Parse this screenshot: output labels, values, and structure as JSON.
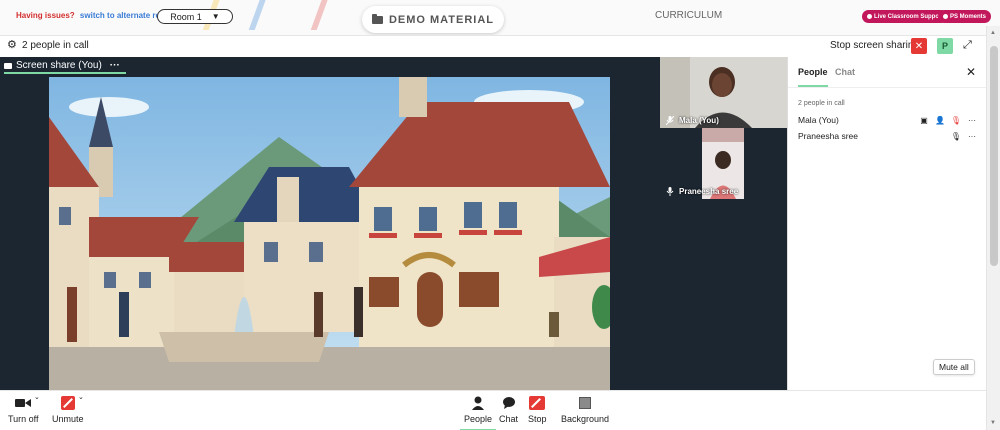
{
  "topbar": {
    "issues_question": "Having issues?",
    "issues_link": "switch to alternate room",
    "room_value": "Room 1",
    "demo_button": "DEMO MATERIAL",
    "curriculum_label": "CURRICULUM",
    "live_support": "Live Classroom Support",
    "ps_moments": "PS Moments"
  },
  "callbar": {
    "people_count": "2 people in call",
    "stop_sharing_label": "Stop screen sharing",
    "stop_sharing_x": "✕",
    "participant_badge": "P"
  },
  "stage": {
    "share_tab_label": "Screen share (You)",
    "share_tab_more": "···",
    "tiles": [
      {
        "name": "Mala (You)",
        "mic": "muted"
      },
      {
        "name": "Praneesha sree",
        "mic": "on"
      }
    ]
  },
  "panel": {
    "tab_people": "People",
    "tab_chat": "Chat",
    "close": "✕",
    "count": "2 people in call",
    "people": [
      {
        "name": "Mala (You)"
      },
      {
        "name": "Praneesha sree"
      }
    ],
    "more": "···",
    "mute_all": "Mute all"
  },
  "controls": {
    "turn_off": "Turn off",
    "unmute": "Unmute",
    "people": "People",
    "chat": "Chat",
    "stop": "Stop",
    "background": "Background"
  },
  "colors": {
    "accent": "#7ed9a4",
    "danger": "#e53935",
    "brand": "#c2185b",
    "stage_bg": "#1b2630"
  }
}
